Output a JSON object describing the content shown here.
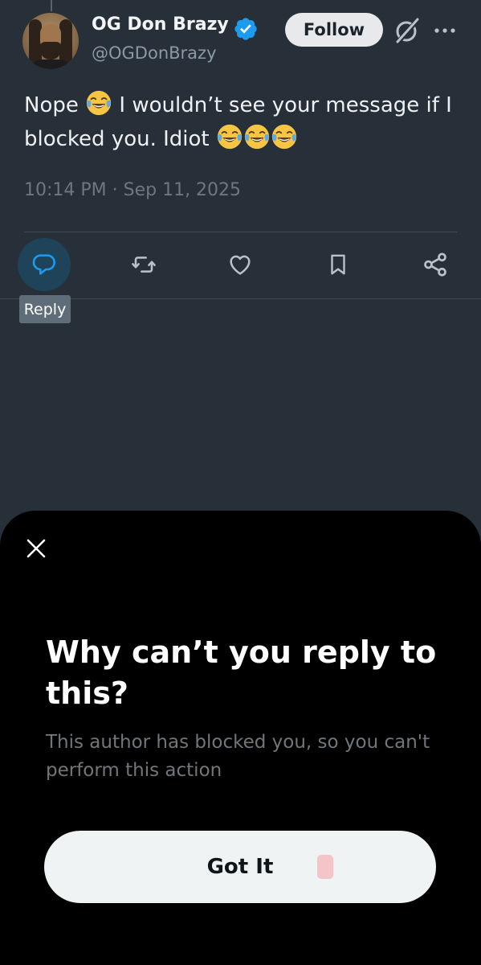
{
  "tweet": {
    "author_name": "OG Don Brazy",
    "handle": "@OGDonBrazy",
    "follow_label": "Follow",
    "text_part1": "Nope ",
    "text_part2": " I wouldn’t see your message if I blocked you. Idiot ",
    "emoji": "face-with-tears-of-joy",
    "timestamp": "10:14 PM · Sep 11, 2025"
  },
  "actions": {
    "tooltip": "Reply",
    "icons": [
      "reply-icon",
      "repost-icon",
      "like-icon",
      "bookmark-icon",
      "share-icon"
    ]
  },
  "sheet": {
    "title": "Why can’t you reply to this?",
    "description": "This author has blocked you, so you can't perform this action",
    "button_label": "Got It"
  },
  "colors": {
    "background": "#273038",
    "sheet": "#000000",
    "accent": "#1d9bf0",
    "button": "#eff3f4"
  }
}
